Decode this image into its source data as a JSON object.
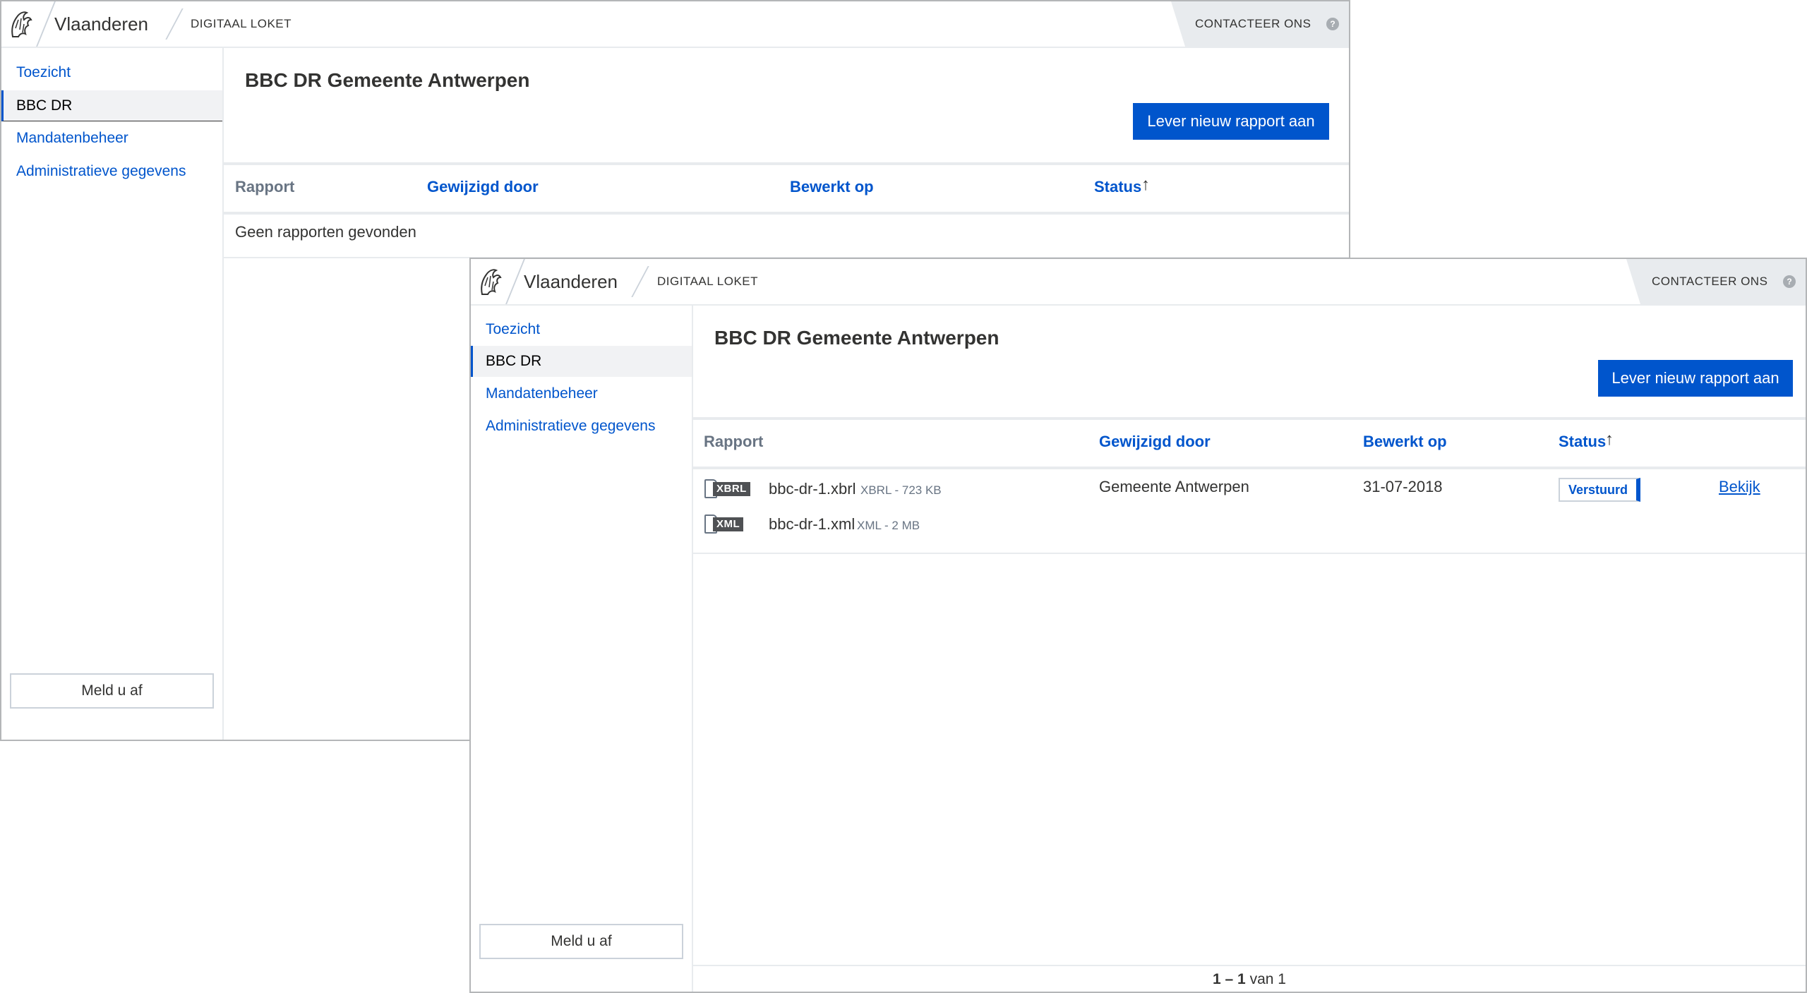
{
  "colors": {
    "primary": "#0055cc",
    "border": "#e8ebee",
    "muted": "#687483",
    "contact_bg": "#e8ebee"
  },
  "back_window": {
    "header": {
      "brand": "Vlaanderen",
      "subtitle": "DIGITAAL LOKET",
      "contact": "CONTACTEER ONS",
      "help_icon": "question-mark-icon",
      "logo_icon": "flemish-lion-icon"
    },
    "sidebar": {
      "items": [
        {
          "label": "Toezicht"
        },
        {
          "label": "BBC DR",
          "active": true
        },
        {
          "label": "Mandatenbeheer"
        },
        {
          "label": "Administratieve gegevens"
        }
      ],
      "logout": "Meld u af"
    },
    "main": {
      "title": "BBC DR Gemeente Antwerpen",
      "action_button": "Lever nieuw rapport aan",
      "columns": [
        "Rapport",
        "Gewijzigd door",
        "Bewerkt op",
        "Status"
      ],
      "sort_arrow": "↑",
      "empty_message": "Geen rapporten gevonden"
    }
  },
  "front_window": {
    "header": {
      "brand": "Vlaanderen",
      "subtitle": "DIGITAAL LOKET",
      "contact": "CONTACTEER ONS",
      "help_icon": "question-mark-icon",
      "logo_icon": "flemish-lion-icon"
    },
    "sidebar": {
      "items": [
        {
          "label": "Toezicht"
        },
        {
          "label": "BBC DR",
          "active": true
        },
        {
          "label": "Mandatenbeheer"
        },
        {
          "label": "Administratieve gegevens"
        }
      ],
      "logout": "Meld u af"
    },
    "main": {
      "title": "BBC DR Gemeente Antwerpen",
      "action_button": "Lever nieuw rapport aan",
      "columns": [
        "Rapport",
        "Gewijzigd door",
        "Bewerkt op",
        "Status"
      ],
      "sort_arrow": "↑",
      "rows": [
        {
          "files": [
            {
              "badge": "XBRL",
              "name": "bbc-dr-1.xbrl",
              "meta": "XBRL - 723 KB"
            },
            {
              "badge": "XML",
              "name": "bbc-dr-1.xml",
              "meta": "XML - 2 MB"
            }
          ],
          "modified_by": "Gemeente Antwerpen",
          "edited_on": "31-07-2018",
          "status": "Verstuurd",
          "action": "Bekijk"
        }
      ],
      "pagination": {
        "range": "1 – 1",
        "suffix": "van 1"
      }
    }
  }
}
